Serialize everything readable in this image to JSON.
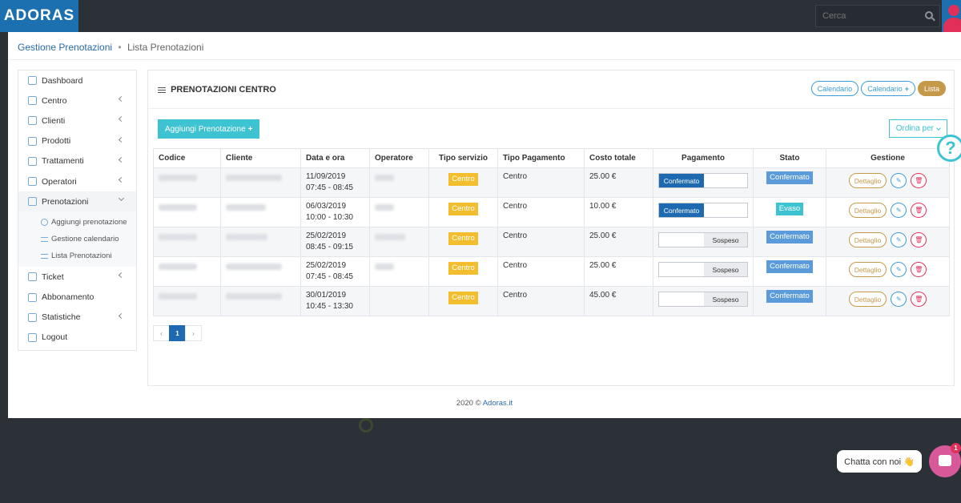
{
  "app": {
    "logo": "ADORAS"
  },
  "search": {
    "placeholder": "Cerca"
  },
  "breadcrumb": {
    "root": "Gestione Prenotazioni",
    "separator": "•",
    "current": "Lista Prenotazioni"
  },
  "sidebar": {
    "items": [
      {
        "label": "Dashboard",
        "icon": "grid-icon",
        "has_chevron": false
      },
      {
        "label": "Centro",
        "icon": "home-icon",
        "has_chevron": true
      },
      {
        "label": "Clienti",
        "icon": "users-icon",
        "has_chevron": true
      },
      {
        "label": "Prodotti",
        "icon": "tag-icon",
        "has_chevron": true
      },
      {
        "label": "Trattamenti",
        "icon": "layers-icon",
        "has_chevron": true
      },
      {
        "label": "Operatori",
        "icon": "user-icon",
        "has_chevron": true
      },
      {
        "label": "Prenotazioni",
        "icon": "calendar-icon",
        "has_chevron": true
      },
      {
        "label": "Ticket",
        "icon": "send-icon",
        "has_chevron": true
      },
      {
        "label": "Abbonamento",
        "icon": "file-icon",
        "has_chevron": false
      },
      {
        "label": "Statistiche",
        "icon": "clock-icon",
        "has_chevron": true
      },
      {
        "label": "Logout",
        "icon": "key-icon",
        "has_chevron": false
      }
    ],
    "sub_items": [
      {
        "label": "Aggiungi prenotazione",
        "icon": "plus-circle-icon"
      },
      {
        "label": "Gestione calendario",
        "icon": "list-icon"
      },
      {
        "label": "Lista Prenotazioni",
        "icon": "list-icon"
      }
    ]
  },
  "card": {
    "title": "PRENOTAZIONI CENTRO",
    "pills": {
      "calendar": "Calendario",
      "calendar_add": "Calendario",
      "list": "Lista"
    },
    "add_button": "Aggiungi Prenotazione",
    "order_button": "Ordina per"
  },
  "table": {
    "headers": [
      "Codice",
      "Cliente",
      "Data e ora",
      "Operatore",
      "Tipo servizio",
      "Tipo Pagamento",
      "Costo totale",
      "Pagamento",
      "Stato",
      "Gestione"
    ],
    "rows": [
      {
        "date": "11/09/2019",
        "time": "07:45 - 08:45",
        "service": "Centro",
        "payment_type": "Centro",
        "cost": "25.00 €",
        "payment": "Confermato",
        "status": "Confermato",
        "status_kind": "blue"
      },
      {
        "date": "06/03/2019",
        "time": "10:00 - 10:30",
        "service": "Centro",
        "payment_type": "Centro",
        "cost": "10.00 €",
        "payment": "Confermato",
        "status": "Evaso",
        "status_kind": "cyan"
      },
      {
        "date": "25/02/2019",
        "time": "08:45 - 09:15",
        "service": "Centro",
        "payment_type": "Centro",
        "cost": "25.00 €",
        "payment": "Sospeso",
        "status": "Confermato",
        "status_kind": "blue"
      },
      {
        "date": "25/02/2019",
        "time": "07:45 - 08:45",
        "service": "Centro",
        "payment_type": "Centro",
        "cost": "25.00 €",
        "payment": "Sospeso",
        "status": "Confermato",
        "status_kind": "blue"
      },
      {
        "date": "30/01/2019",
        "time": "10:45 - 13:30",
        "service": "Centro",
        "payment_type": "Centro",
        "cost": "45.00 €",
        "payment": "Sospeso",
        "status": "Confermato",
        "status_kind": "blue"
      }
    ],
    "detail_label": "Dettaglio"
  },
  "pagination": {
    "prev": "‹",
    "current": "1",
    "next": "›"
  },
  "footer": {
    "text": "2020 ©",
    "link": "Adoras.it"
  },
  "help": {
    "label": "?"
  },
  "chat": {
    "label": "Chatta con noi 👋",
    "badge": "1"
  },
  "colors": {
    "primary": "#1d70b0",
    "accent_cyan": "#3ec3d2",
    "gold": "#c49a4a",
    "danger": "#e0305a",
    "warning": "#f2be2d"
  }
}
